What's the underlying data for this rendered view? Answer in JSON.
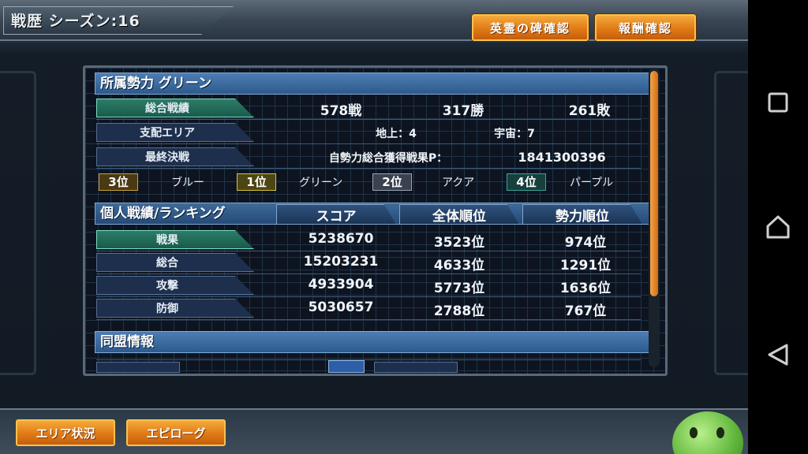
{
  "header": {
    "title": "戦歴 シーズン:16",
    "btn_monument": "英霊の碑確認",
    "btn_reward": "報酬確認"
  },
  "faction": {
    "head": "所属勢力 グリーン",
    "rows": [
      {
        "label": "総合戦績",
        "v1": "578戦",
        "v2": "317勝",
        "v3": "261敗"
      },
      {
        "label": "支配エリア",
        "v1": "地上：4",
        "v2": "宇宙：7"
      },
      {
        "label": "最終決戦",
        "v1": "自勢力総合獲得戦果P：",
        "v2": "1841300396"
      }
    ],
    "ranks": [
      {
        "rank": "3位",
        "name": "ブルー",
        "color": "#c9a23a"
      },
      {
        "rank": "1位",
        "name": "グリーン",
        "color": "#d8c23a"
      },
      {
        "rank": "2位",
        "name": "アクア",
        "color": "#9aa3b0"
      },
      {
        "rank": "4位",
        "name": "パープル",
        "color": "#3aa39a"
      }
    ]
  },
  "personal": {
    "head": "個人戦績/ランキング",
    "cols": [
      "スコア",
      "全体順位",
      "勢力順位"
    ],
    "rows": [
      {
        "label": "戦果",
        "score": "5238670",
        "overall": "3523位",
        "faction": "974位"
      },
      {
        "label": "総合",
        "score": "15203231",
        "overall": "4633位",
        "faction": "1291位"
      },
      {
        "label": "攻撃",
        "score": "4933904",
        "overall": "5773位",
        "faction": "1636位"
      },
      {
        "label": "防御",
        "score": "5030657",
        "overall": "2788位",
        "faction": "767位"
      }
    ]
  },
  "alliance": {
    "head": "同盟情報"
  },
  "footer": {
    "btn_area": "エリア状況",
    "btn_epilogue": "エピローグ"
  },
  "nav": {
    "icons": [
      "recent-apps-icon",
      "home-icon",
      "back-icon"
    ]
  }
}
